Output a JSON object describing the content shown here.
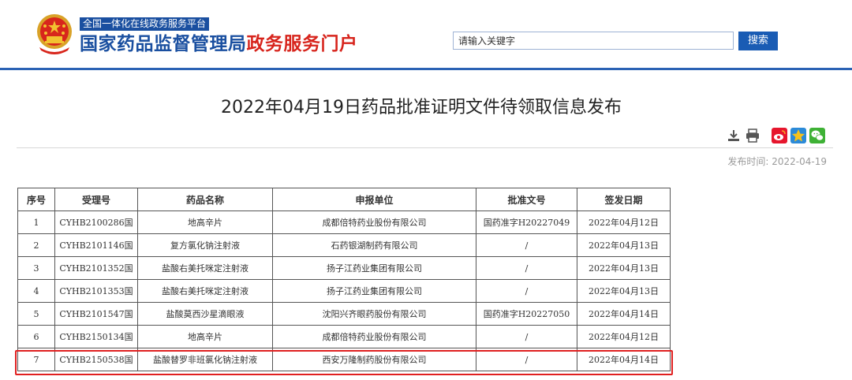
{
  "header": {
    "tagline": "全国一体化在线政务服务平台",
    "brand_blue": "国家药品监督管理局",
    "brand_red": "政务服务门户",
    "search_placeholder": "请输入关键字",
    "search_button": "搜索",
    "colors": {
      "primary": "#1a4fa0",
      "accent_red": "#d7241c",
      "header_line": "#2b62b4"
    }
  },
  "article": {
    "title": "2022年04月19日药品批准证明文件待领取信息发布",
    "publish_date": "发布时间:  2022-04-19"
  },
  "tools": [
    "download-icon",
    "print-icon",
    "weibo-share-icon",
    "qzone-share-icon",
    "wechat-share-icon"
  ],
  "table": {
    "headers": [
      "序号",
      "受理号",
      "药品名称",
      "申报单位",
      "批准文号",
      "签发日期"
    ],
    "rows": [
      [
        "1",
        "CYHB2100286国",
        "地高辛片",
        "成都倍特药业股份有限公司",
        "国药准字H20227049",
        "2022年04月12日"
      ],
      [
        "2",
        "CYHB2101146国",
        "复方氯化钠注射液",
        "石药银湖制药有限公司",
        "/",
        "2022年04月13日"
      ],
      [
        "3",
        "CYHB2101352国",
        "盐酸右美托咪定注射液",
        "扬子江药业集团有限公司",
        "/",
        "2022年04月13日"
      ],
      [
        "4",
        "CYHB2101353国",
        "盐酸右美托咪定注射液",
        "扬子江药业集团有限公司",
        "/",
        "2022年04月13日"
      ],
      [
        "5",
        "CYHB2101547国",
        "盐酸莫西沙星滴眼液",
        "沈阳兴齐眼药股份有限公司",
        "国药准字H20227050",
        "2022年04月14日"
      ],
      [
        "6",
        "CYHB2150134国",
        "地高辛片",
        "成都倍特药业股份有限公司",
        "/",
        "2022年04月12日"
      ],
      [
        "7",
        "CYHB2150538国",
        "盐酸替罗非班氯化钠注射液",
        "西安万隆制药股份有限公司",
        "/",
        "2022年04月14日"
      ]
    ],
    "highlight_color": "#e02020"
  }
}
